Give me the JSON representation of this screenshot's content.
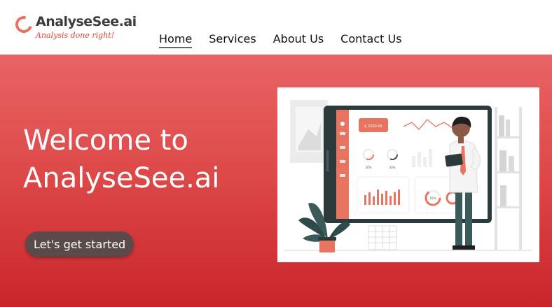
{
  "brand": {
    "name": "AnalyseSee.ai",
    "tagline": "Analysis done right!"
  },
  "nav": {
    "items": [
      {
        "label": "Home",
        "active": true
      },
      {
        "label": "Services",
        "active": false
      },
      {
        "label": "About Us",
        "active": false
      },
      {
        "label": "Contact Us",
        "active": false
      }
    ]
  },
  "hero": {
    "title_line1": "Welcome to",
    "title_line2": "AnalyseSee.ai",
    "cta_label": "Let's get started"
  },
  "illustration": {
    "card_value": "$ 2100.00",
    "stat_left": "30%",
    "stat_right": "30%",
    "donut_label": "65%"
  },
  "colors": {
    "accent": "#e8735f",
    "hero_top": "#e86464",
    "hero_bottom": "#c9252a",
    "cta_bg": "#5a4a4a"
  }
}
